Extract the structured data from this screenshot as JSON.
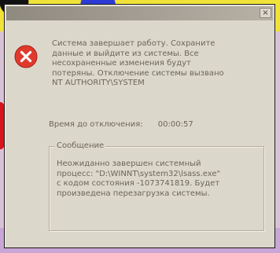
{
  "window": {
    "title": "",
    "close_glyph": "×"
  },
  "icon": {
    "name": "error-icon",
    "color": "#e03a2c"
  },
  "message": {
    "line1": "Система завершает работу. Сохраните",
    "line2": "данные и выйдите из системы. Все",
    "line3": "несохраненные изменения будут",
    "line4": "потеряны. Отключение системы вызвано",
    "line5": "NT AUTHORITY\\SYSTEM"
  },
  "timer": {
    "label": "Время до отключения:",
    "value": "00:00:57"
  },
  "group": {
    "legend": "Сообщение",
    "line1": "Неожиданно завершен системный",
    "line2": "процесс: \"D:\\WINNT\\system32\\lsass.exe\"",
    "line3": "с кодом состояния -1073741819. Будет",
    "line4": "произведена перезагрузка системы."
  }
}
